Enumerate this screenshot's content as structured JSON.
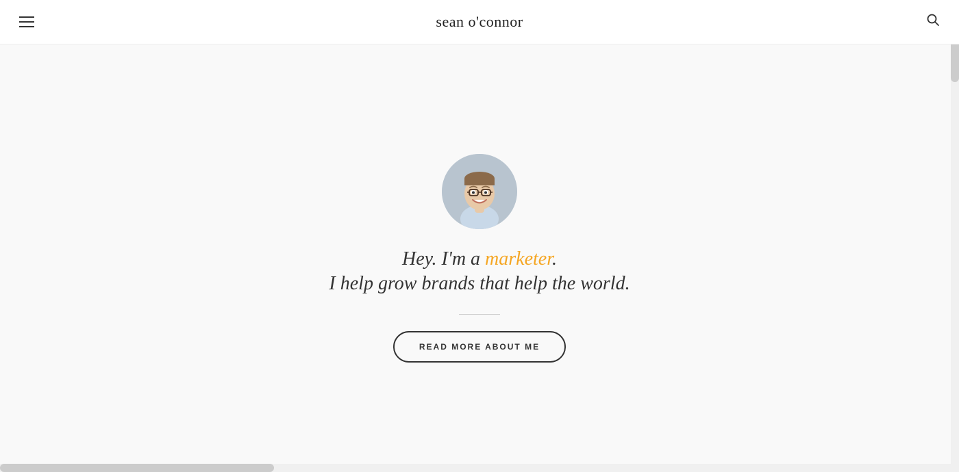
{
  "header": {
    "title": "sean o'connor",
    "hamburger_label": "menu",
    "search_label": "search"
  },
  "hero": {
    "tagline_prefix": "Hey. I'm a ",
    "tagline_highlight": "marketer",
    "tagline_suffix": ".",
    "tagline_line2": "I help grow brands that help the world.",
    "cta_button_label": "READ MORE ABOUT ME"
  },
  "colors": {
    "accent": "#f5a623",
    "text_dark": "#333333",
    "border": "#333333"
  }
}
